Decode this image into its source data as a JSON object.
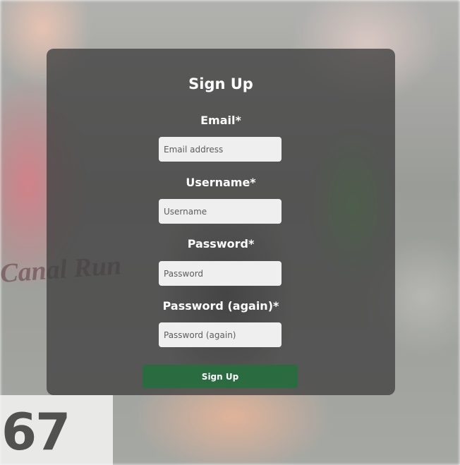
{
  "form": {
    "title": "Sign Up",
    "fields": [
      {
        "label": "Email*",
        "placeholder": "Email address",
        "value": ""
      },
      {
        "label": "Username*",
        "placeholder": "Username",
        "value": ""
      },
      {
        "label": "Password*",
        "placeholder": "Password",
        "value": ""
      },
      {
        "label": "Password (again)*",
        "placeholder": "Password (again)",
        "value": ""
      }
    ],
    "submit_label": "Sign Up"
  },
  "background": {
    "bib_number": "67",
    "shirt_text": "Canal Run"
  },
  "colors": {
    "card": "#404040",
    "button": "#2a6b40",
    "input": "#efefef"
  }
}
